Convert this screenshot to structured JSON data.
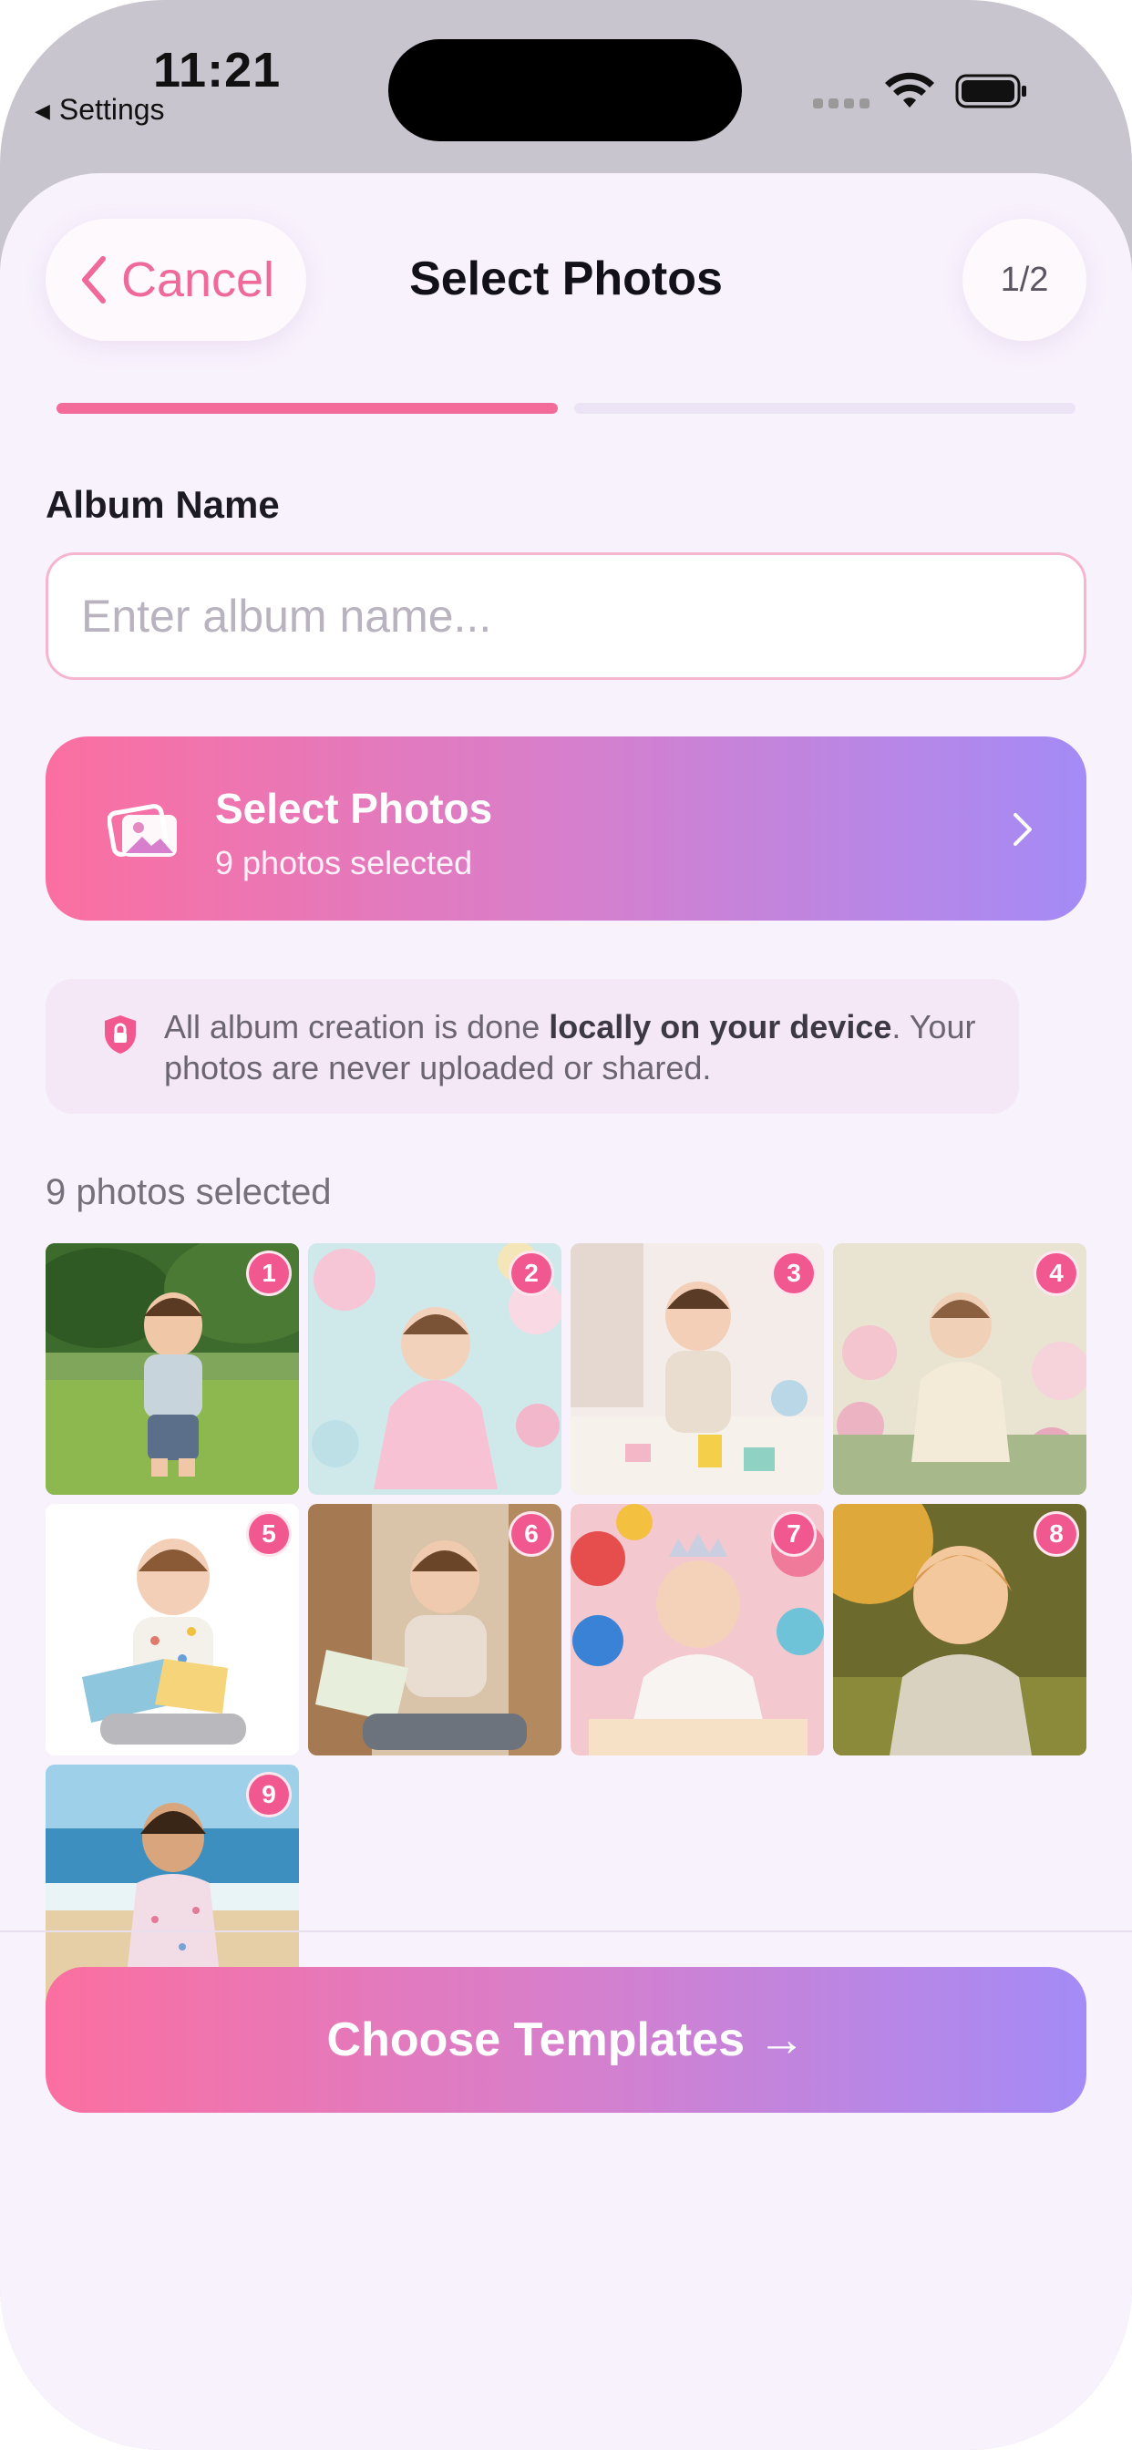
{
  "status_bar": {
    "time": "11:21",
    "back_app": "Settings"
  },
  "header": {
    "cancel_label": "Cancel",
    "title": "Select Photos",
    "step": "1/2"
  },
  "progress": {
    "current_step": 1,
    "total_steps": 2
  },
  "album": {
    "label": "Album Name",
    "placeholder": "Enter album name...",
    "value": ""
  },
  "select_card": {
    "title": "Select Photos",
    "subtitle": "9 photos selected"
  },
  "privacy": {
    "text_before": "All album creation is done ",
    "text_bold": "locally on your device",
    "text_after": ". Your photos are never uploaded or shared."
  },
  "photos": {
    "count_label": "9 photos selected",
    "items": [
      {
        "number": "1",
        "scene": "toddler-in-park"
      },
      {
        "number": "2",
        "scene": "baby-pastel-party"
      },
      {
        "number": "3",
        "scene": "baby-with-toys"
      },
      {
        "number": "4",
        "scene": "baby-in-flowers"
      },
      {
        "number": "5",
        "scene": "baby-reading-white"
      },
      {
        "number": "6",
        "scene": "baby-reading-room"
      },
      {
        "number": "7",
        "scene": "baby-birthday-tiara"
      },
      {
        "number": "8",
        "scene": "baby-sunset-field"
      },
      {
        "number": "9",
        "scene": "toddler-at-beach"
      }
    ]
  },
  "cta": {
    "label": "Choose Templates →"
  },
  "colors": {
    "accent_pink": "#f26b9b",
    "gradient_start": "#fb6fa0",
    "gradient_end": "#a48bf6",
    "background": "#f8f2fd"
  }
}
